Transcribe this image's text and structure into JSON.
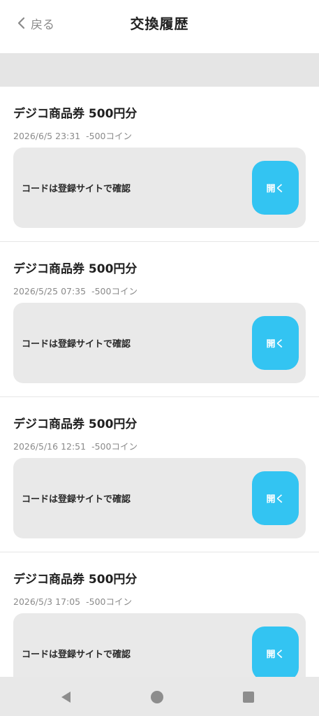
{
  "header": {
    "back_label": "戻る",
    "title": "交換履歴"
  },
  "entries": [
    {
      "title": "デジコ商品券 500円分",
      "date": "2026/6/5 23:31",
      "cost": "-500コイン",
      "code_text": "コードは登録サイトで確認",
      "open_label": "開く"
    },
    {
      "title": "デジコ商品券 500円分",
      "date": "2026/5/25 07:35",
      "cost": "-500コイン",
      "code_text": "コードは登録サイトで確認",
      "open_label": "開く"
    },
    {
      "title": "デジコ商品券 500円分",
      "date": "2026/5/16 12:51",
      "cost": "-500コイン",
      "code_text": "コードは登録サイトで確認",
      "open_label": "開く"
    },
    {
      "title": "デジコ商品券 500円分",
      "date": "2026/5/3 17:05",
      "cost": "-500コイン",
      "code_text": "コードは登録サイトで確認",
      "open_label": "開く"
    }
  ],
  "colors": {
    "accent": "#33c4f2",
    "background_gray": "#e5e5e5"
  },
  "nav_icons": [
    "back-triangle-icon",
    "home-circle-icon",
    "recent-square-icon"
  ]
}
